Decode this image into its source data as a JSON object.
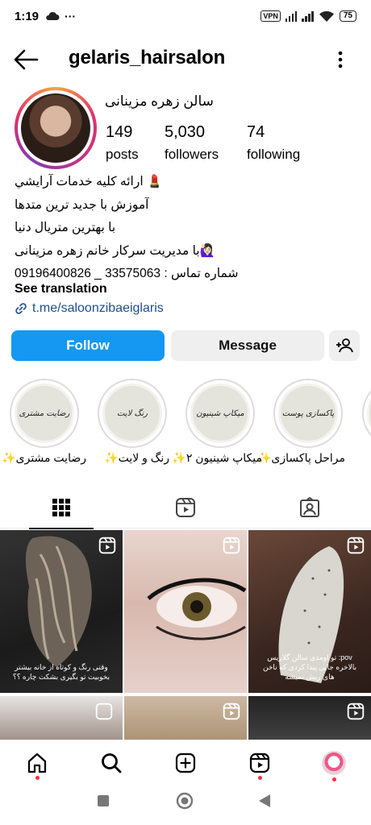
{
  "status_bar": {
    "time": "1:19",
    "more": "···",
    "vpn": "VPN",
    "battery": "75"
  },
  "header": {
    "username": "gelaris_hairsalon"
  },
  "profile": {
    "full_name": "سالن زهره مزینانی",
    "stats": [
      {
        "value": "149",
        "label": "posts"
      },
      {
        "value": "5,030",
        "label": "followers"
      },
      {
        "value": "74",
        "label": "following"
      }
    ],
    "bio": [
      "💄 ارائه کلیه خدمات آرايشي",
      "آموزش با جدید ترین متدها",
      "با بهترین متریال دنیا",
      "🙋🏻‍♀️با مدیریت سرکار خانم زهره مزینانی",
      "شماره تماس : 33575063 _ 09196400826"
    ],
    "see_translation": "See translation",
    "link": "t.me/saloonzibaeiglaris"
  },
  "actions": {
    "follow": "Follow",
    "message": "Message"
  },
  "highlights": [
    {
      "name": "مراحل پاکسازی✨",
      "cover_text": "پاکسازی پوست"
    },
    {
      "name": "میکاپ شینیون ۲✨",
      "cover_text": "میکاپ شینیون"
    },
    {
      "name": "رنگ و لایت✨",
      "cover_text": "رنگ لایت"
    },
    {
      "name": "رضایت مشتری✨",
      "cover_text": "رضایت مشتری"
    }
  ],
  "grid": {
    "captions": [
      "وقتی رنگ و کوتاه از خانه بیشتر بخوبیت تو بگیری بشکت چاره ؟؟",
      "",
      "pov: تو اومدی سالن گلاریس بالاخره جایی پیدا کردی که ناخن های ریش نمیشه"
    ]
  },
  "colors": {
    "follow_blue": "#1498f2",
    "link_blue": "#1c4e8f",
    "notification_red": "#ff3040"
  }
}
